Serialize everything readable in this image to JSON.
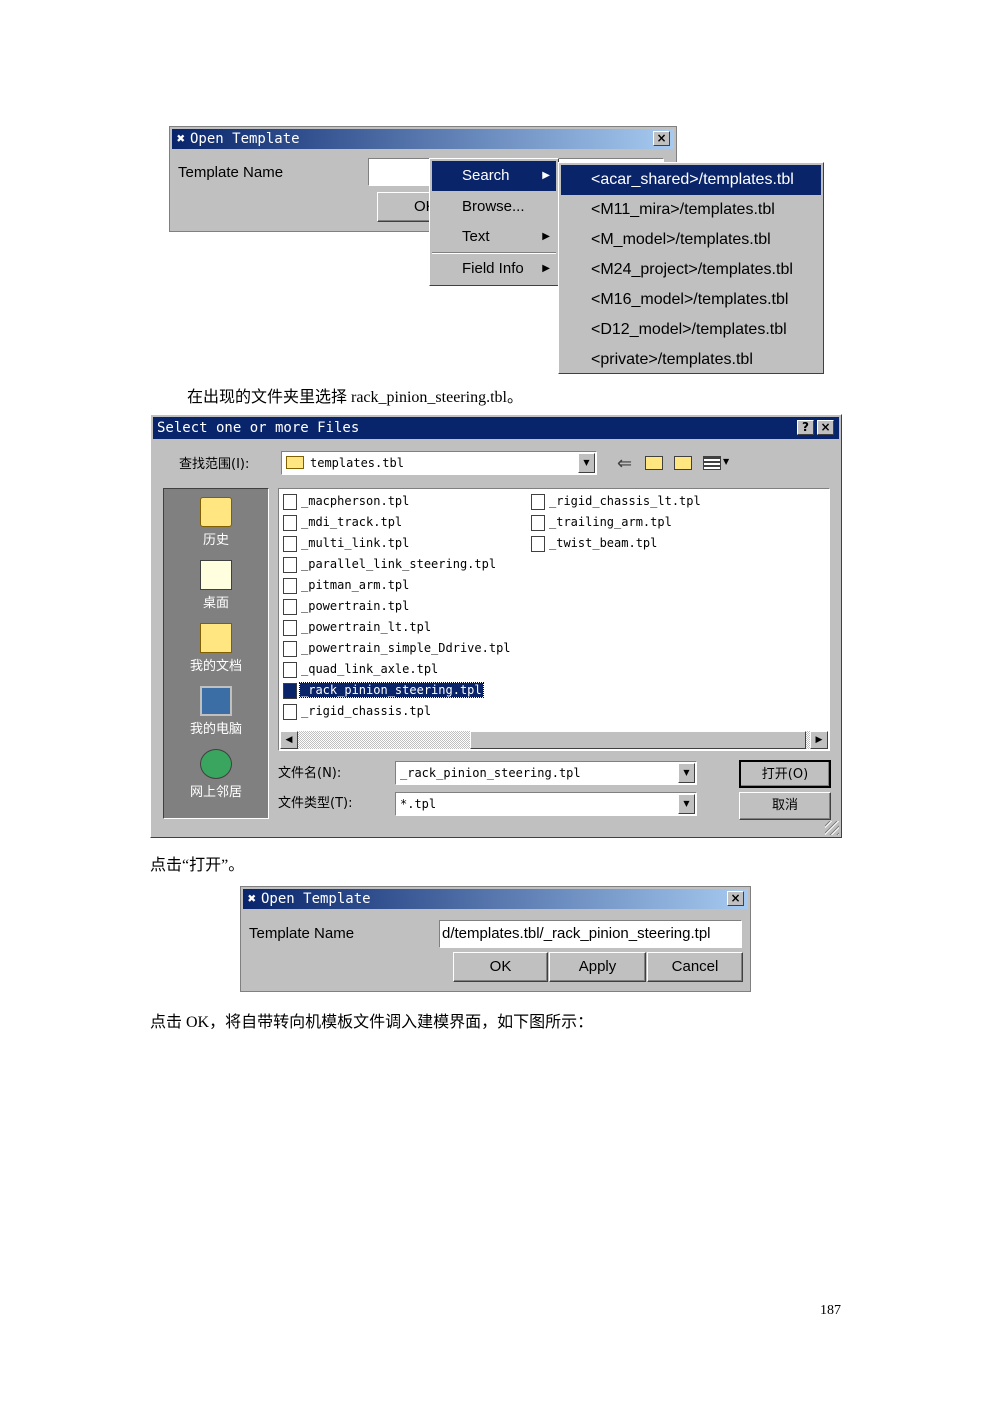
{
  "dialog1": {
    "title": "Open Template",
    "label": "Template Name",
    "ok_label": "OK"
  },
  "context_menu": {
    "items": [
      {
        "label": "Search",
        "has_submenu": true,
        "selected": true
      },
      {
        "label": "Browse...",
        "has_submenu": false
      },
      {
        "label": "Text",
        "has_submenu": true
      },
      {
        "label": "Field Info",
        "has_submenu": true
      }
    ]
  },
  "submenu": {
    "items": [
      "<acar_shared>/templates.tbl",
      "<M11_mira>/templates.tbl",
      "<M_model>/templates.tbl",
      "<M24_project>/templates.tbl",
      "<M16_model>/templates.tbl",
      "<D12_model>/templates.tbl",
      "<private>/templates.tbl"
    ]
  },
  "caption1": "在出现的文件夹里选择 rack_pinion_steering.tbl。",
  "file_dialog": {
    "title": "Select one or more Files",
    "look_in_label": "查找范围(I):",
    "look_in_value": "templates.tbl",
    "places": [
      "历史",
      "桌面",
      "我的文档",
      "我的电脑",
      "网上邻居"
    ],
    "files_col1": [
      "_macpherson.tpl",
      "_mdi_track.tpl",
      "_multi_link.tpl",
      "_parallel_link_steering.tpl",
      "_pitman_arm.tpl",
      "_powertrain.tpl",
      "_powertrain_lt.tpl",
      "_powertrain_simple_Ddrive.tpl",
      "_quad_link_axle.tpl",
      "_rack_pinion_steering.tpl",
      "_rigid_chassis.tpl"
    ],
    "files_col2": [
      "_rigid_chassis_lt.tpl",
      "_trailing_arm.tpl",
      "_twist_beam.tpl"
    ],
    "selected_file": "_rack_pinion_steering.tpl",
    "filename_label": "文件名(N):",
    "filename_value": "_rack_pinion_steering.tpl",
    "filetype_label": "文件类型(T):",
    "filetype_value": "*.tpl",
    "open_label": "打开(O)",
    "cancel_label": "取消",
    "help_btn": "?",
    "close_btn": "×"
  },
  "caption2": "点击“打开”。",
  "dialog2": {
    "title": "Open Template",
    "label": "Template Name",
    "value": "d/templates.tbl/_rack_pinion_steering.tpl",
    "ok_label": "OK",
    "apply_label": "Apply",
    "cancel_label": "Cancel"
  },
  "caption3": "点击 OK，将自带转向机模板文件调入建模界面，如下图所示：",
  "page_number": "187",
  "colors": {
    "titlebar_start": "#08246b",
    "titlebar_end": "#a6caf0",
    "selection": "#0a246a",
    "window_face": "#c0c0c0",
    "places_bar": "#808080"
  }
}
